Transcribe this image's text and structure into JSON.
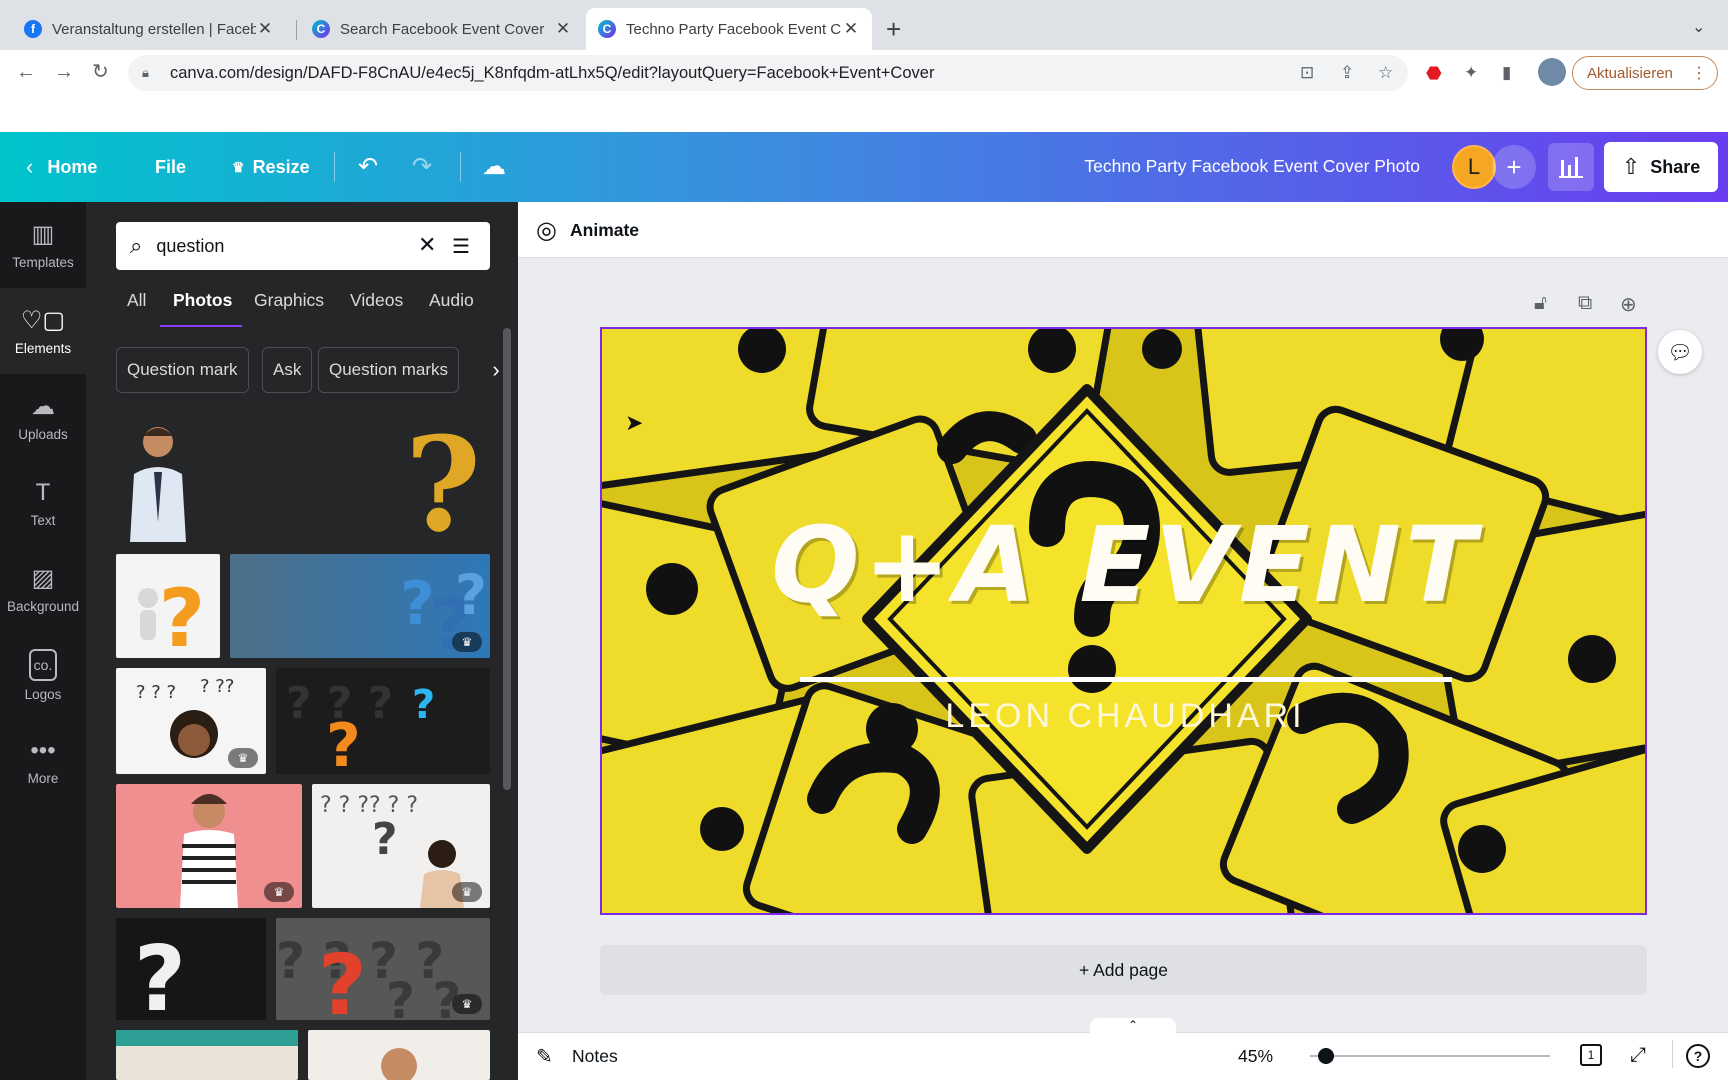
{
  "browser": {
    "tabs": [
      {
        "title": "Veranstaltung erstellen | Faceb",
        "favicon": "facebook-icon"
      },
      {
        "title": "Search Facebook Event Cover",
        "favicon": "canva-icon"
      },
      {
        "title": "Techno Party Facebook Event C",
        "favicon": "canva-icon"
      }
    ],
    "new_tab": "+",
    "url": "canva.com/design/DAFD-F8CnAU/e4ec5j_K8nfqdm-atLhx5Q/edit?layoutQuery=Facebook+Event+Cover",
    "update_button": "Aktualisieren"
  },
  "header": {
    "home": "Home",
    "file": "File",
    "resize": "Resize",
    "title": "Techno Party Facebook Event Cover Photo",
    "avatar_letter": "L",
    "share": "Share"
  },
  "rail": [
    {
      "label": "Templates",
      "icon": "templates-icon"
    },
    {
      "label": "Elements",
      "icon": "elements-icon"
    },
    {
      "label": "Uploads",
      "icon": "upload-icon"
    },
    {
      "label": "Text",
      "icon": "text-icon"
    },
    {
      "label": "Background",
      "icon": "background-icon"
    },
    {
      "label": "Logos",
      "icon": "logos-icon"
    },
    {
      "label": "More",
      "icon": "more-icon"
    }
  ],
  "panel": {
    "search_value": "question",
    "tabs": [
      "All",
      "Photos",
      "Graphics",
      "Videos",
      "Audio"
    ],
    "active_tab": "Photos",
    "chips": [
      "Question mark",
      "Ask",
      "Question marks"
    ]
  },
  "editor": {
    "animate": "Animate",
    "add_page": "+ Add page",
    "notes": "Notes",
    "zoom": "45%",
    "page_number": "1"
  },
  "design": {
    "title": "Q+A EVENT",
    "subtitle": "LEON CHAUDHARI"
  },
  "colors": {
    "accent": "#8b3dff",
    "sign_yellow": "#e8d51f",
    "header_start": "#00c4cc",
    "header_end": "#6a3df0"
  }
}
